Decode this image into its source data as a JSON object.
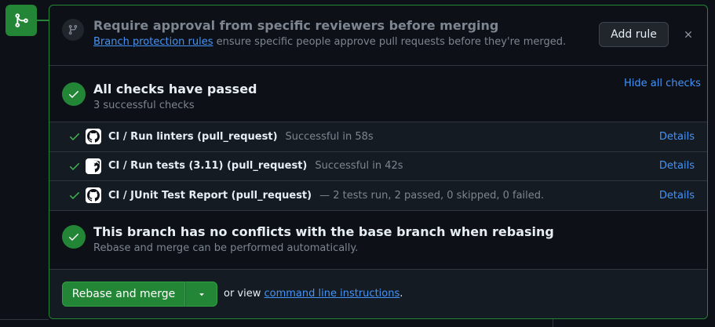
{
  "approval": {
    "title": "Require approval from specific reviewers before merging",
    "link_text": "Branch protection rules",
    "subtitle_rest": " ensure specific people approve pull requests before they're merged.",
    "add_rule_label": "Add rule",
    "close_glyph": "✕"
  },
  "checks": {
    "title": "All checks have passed",
    "subtitle": "3 successful checks",
    "toggle_label": "Hide all checks",
    "items": [
      {
        "name": "CI / Run linters (pull_request)",
        "status": "Successful in 58s",
        "details": "Details"
      },
      {
        "name": "CI / Run tests (3.11) (pull_request)",
        "status": "Successful in 42s",
        "details": "Details"
      },
      {
        "name": "CI / JUnit Test Report (pull_request)",
        "status": "— 2 tests run, 2 passed, 0 skipped, 0 failed.",
        "details": "Details"
      }
    ]
  },
  "conflicts": {
    "title": "This branch has no conflicts with the base branch when rebasing",
    "subtitle": "Rebase and merge can be performed automatically."
  },
  "merge": {
    "button_label": "Rebase and merge",
    "alt_prefix": "or view ",
    "alt_link": "command line instructions",
    "alt_suffix": "."
  },
  "colors": {
    "success": "#238636",
    "link": "#4493f8",
    "background": "#0d1117",
    "muted": "#7d8590"
  },
  "icons": {
    "merge": "git-merge-icon",
    "approval": "git-branch-icon",
    "check": "check-icon",
    "github": "github-logo-icon",
    "caret": "triangle-down-icon",
    "close": "close-icon"
  }
}
